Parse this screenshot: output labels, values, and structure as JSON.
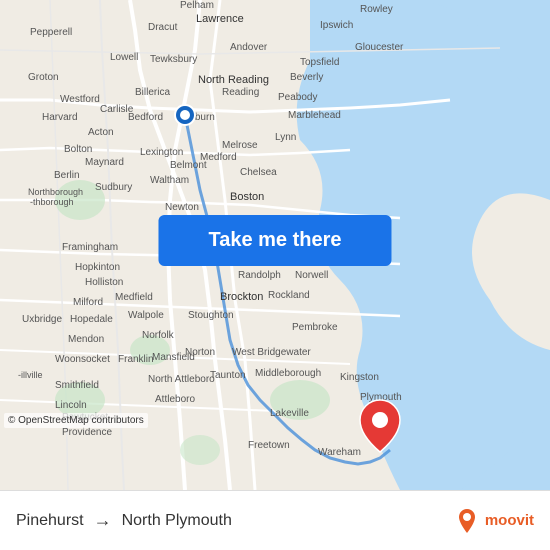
{
  "map": {
    "background_color": "#e8f4e8",
    "water_color": "#b3d9f5",
    "road_color": "#ffffff",
    "land_color": "#f0ece4"
  },
  "button": {
    "label": "Take me there",
    "background": "#1a73e8"
  },
  "bottom_bar": {
    "origin": "Pinehurst",
    "destination": "North Plymouth",
    "arrow": "→"
  },
  "attribution": {
    "text": "© OpenStreetMap contributors"
  },
  "moovit": {
    "text": "moovit"
  },
  "locations": {
    "north_reading": "North Reading",
    "lawrence": "Lawrence"
  }
}
